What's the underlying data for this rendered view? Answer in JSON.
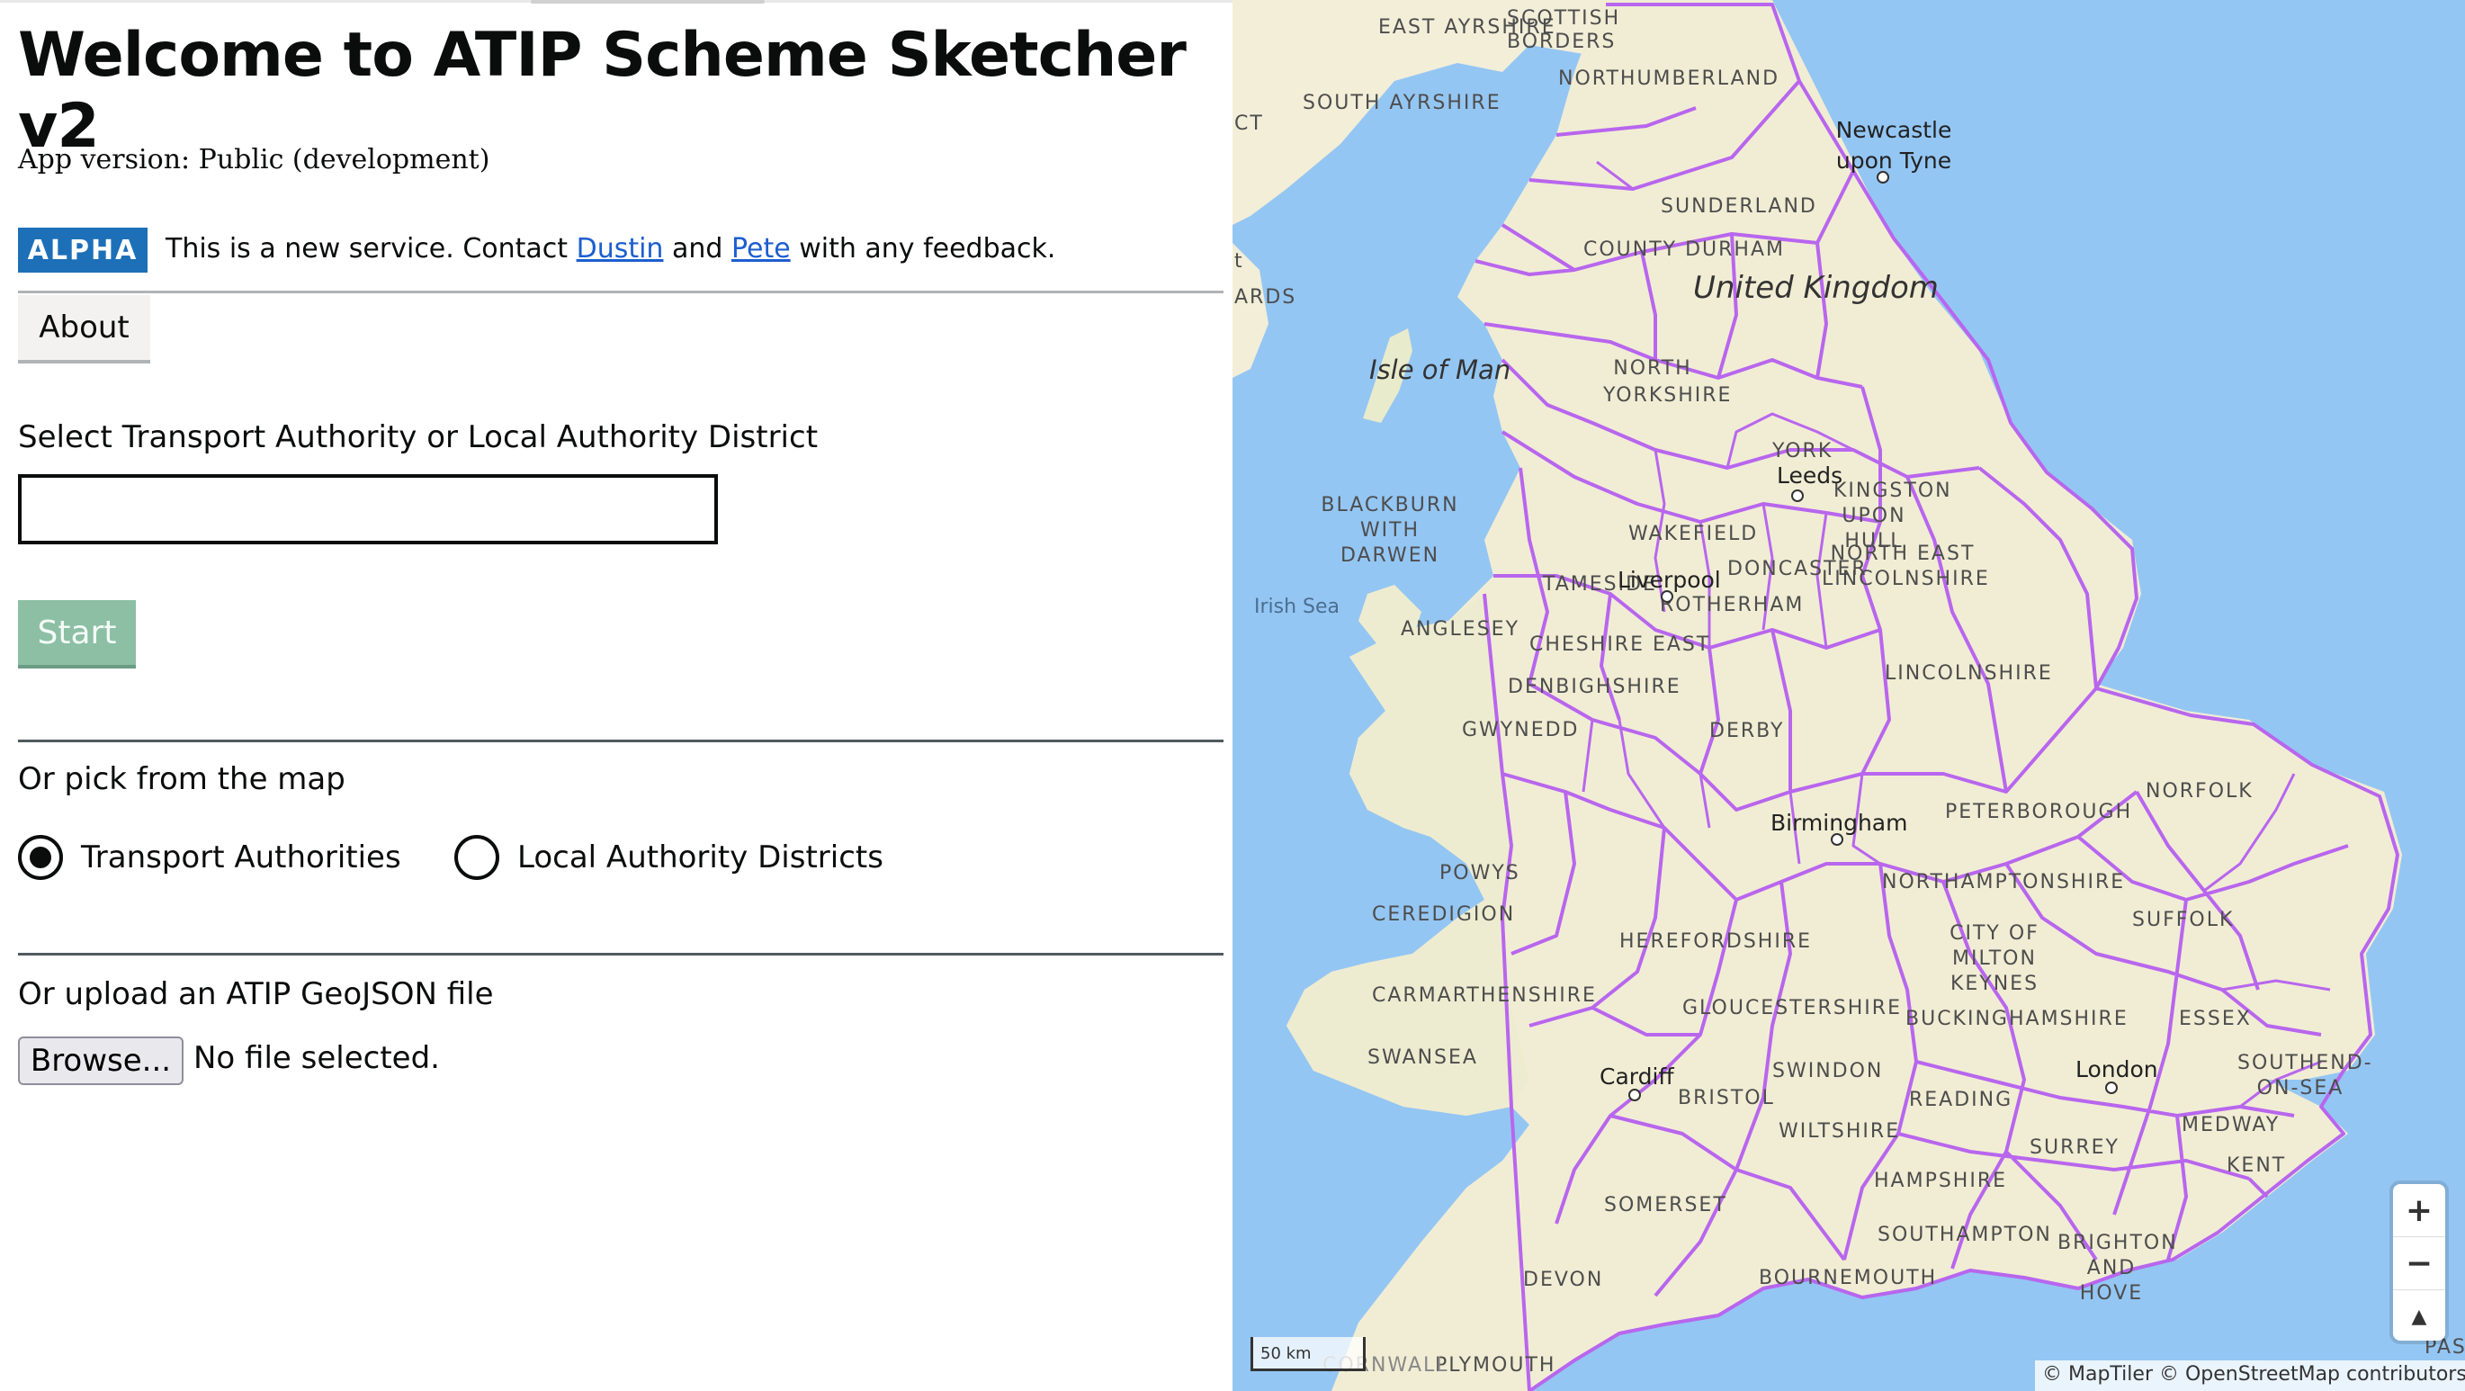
{
  "header": {
    "title": "Welcome to ATIP Scheme Sketcher v2",
    "app_version": "App version: Public (development)"
  },
  "phase_banner": {
    "tag": "ALPHA",
    "text_before": "This is a new service. Contact ",
    "link_1": "Dustin",
    "text_middle": " and ",
    "link_2": "Pete",
    "text_after": " with any feedback."
  },
  "about_button": "About",
  "authority_select": {
    "label": "Select Transport Authority or Local Authority District",
    "value": "",
    "placeholder": ""
  },
  "start_button": "Start",
  "map_picker": {
    "label": "Or pick from the map",
    "options": [
      {
        "label": "Transport Authorities",
        "selected": true
      },
      {
        "label": "Local Authority Districts",
        "selected": false
      }
    ]
  },
  "upload": {
    "label": "Or upload an ATIP GeoJSON file",
    "browse_button": "Browse...",
    "status": "No file selected."
  },
  "map": {
    "country_label": "United Kingdom",
    "islands": [
      "Isle of Man"
    ],
    "seas": [
      "Irish Sea"
    ],
    "cities": [
      "Newcastle upon Tyne",
      "Leeds",
      "Liverpool",
      "Birmingham",
      "Cardiff",
      "London"
    ],
    "regions": [
      "EAST AYRSHIRE",
      "SCOTTISH BORDERS",
      "NORTHUMBERLAND",
      "SOUTH AYRSHIRE",
      "SUNDERLAND",
      "COUNTY DURHAM",
      "NORTH YORKSHIRE",
      "YORK",
      "KINGSTON UPON HULL",
      "BLACKBURN WITH DARWEN",
      "WAKEFIELD",
      "NORTH EAST LINCOLNSHIRE",
      "DONCASTER",
      "TAMESIDE",
      "ROTHERHAM",
      "ANGLESEY",
      "CHESHIRE EAST",
      "LINCOLNSHIRE",
      "DENBIGHSHIRE",
      "GWYNEDD",
      "DERBY",
      "NORFOLK",
      "PETERBOROUGH",
      "POWYS",
      "NORTHAMPTONSHIRE",
      "SUFFOLK",
      "CEREDIGION",
      "HEREFORDSHIRE",
      "CITY OF MILTON KEYNES",
      "CARMARTHENSHIRE",
      "GLOUCESTERSHIRE",
      "BUCKINGHAMSHIRE",
      "ESSEX",
      "SWANSEA",
      "BRISTOL",
      "SWINDON",
      "READING",
      "SOUTHEND-ON-SEA",
      "WILTSHIRE",
      "SURREY",
      "MEDWAY",
      "KENT",
      "HAMPSHIRE",
      "SOMERSET",
      "SOUTHAMPTON",
      "BRIGHTON AND HOVE",
      "DEVON",
      "BOURNEMOUTH",
      "PLYMOUTH",
      "CORNWALL",
      "PAS"
    ],
    "edge_fragments": [
      "CT",
      "t",
      "ARDS"
    ],
    "boundary_color": "#b866ee",
    "zoom_in": "+",
    "zoom_out": "−",
    "compass": "▲",
    "scale_label": "50 km",
    "attribution": "© MapTiler © OpenStreetMap contributors"
  },
  "colors": {
    "alpha_tag": "#1d70b8",
    "start_button": "#8cbfa4",
    "sea": "#94c6f3",
    "land": "#f3efd9"
  }
}
